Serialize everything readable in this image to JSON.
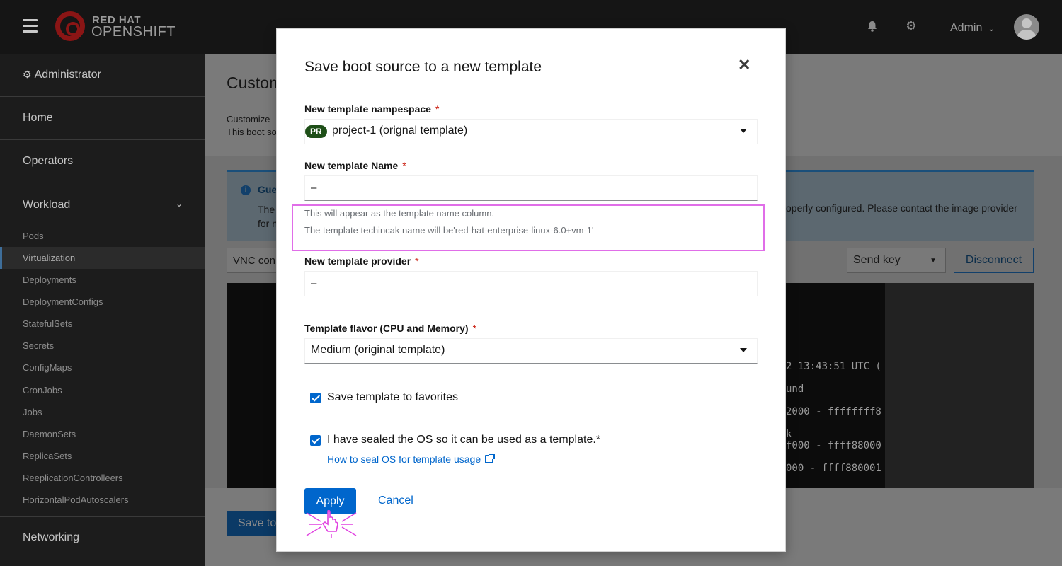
{
  "masthead": {
    "logo_top": "RED HAT",
    "logo_bottom": "OPENSHIFT",
    "user": "Admin"
  },
  "sidebar": {
    "perspective": "Administrator",
    "sections": [
      "Home",
      "Operators",
      "Workload",
      "Networking"
    ],
    "workload_items": [
      "Pods",
      "Virtualization",
      "Deployments",
      "DeploymentConfigs",
      "StatefulSets",
      "Secrets",
      "ConfigMaps",
      "CronJobs",
      "Jobs",
      "DaemonSets",
      "ReplicaSets",
      "ReeplicationControlleers",
      "HorizontalPodAutoscalers"
    ],
    "active_item": "Virtualization"
  },
  "background": {
    "page_title": "Custom",
    "desc_line1": "Customize",
    "desc_line2": "This boot so",
    "alert_title": "Gue",
    "alert_line1": "The",
    "alert_line2": "for n",
    "alert_right": "operly configured. Please contact the image provider",
    "vnc_select": "VNC con",
    "send_key": "Send key",
    "disconnect": "Disconnect",
    "console_lines": [
      "2 13:43:51 UTC (",
      "und",
      "2000 - ffffffff8",
      "k",
      "f000 - ffff88000",
      "000 - ffff880001"
    ],
    "save_to": "Save to"
  },
  "modal": {
    "title": "Save boot source to a new template",
    "namespace_label": "New template nampespace",
    "namespace_badge": "PR",
    "namespace_value": "project-1 (orignal template)",
    "name_label": "New template Name",
    "name_value": "–",
    "helper_line1": "This will appear as the template name column.",
    "helper_line2": "The template techincak name will be'red-hat-enterprise-linux-6.0+vm-1'",
    "provider_label": "New template provider",
    "provider_value": "–",
    "flavor_label": "Template flavor (CPU and Memory)",
    "flavor_value": "Medium (original template)",
    "favorites_label": "Save template to favorites",
    "favorites_checked": true,
    "sealed_label": "I have sealed the OS so it can be used as a template.*",
    "sealed_checked": true,
    "seal_link": "How to seal OS for template usage",
    "apply": "Apply",
    "cancel": "Cancel",
    "required_mark": "*"
  },
  "colors": {
    "primary": "#0066cc",
    "required": "#c9190b",
    "highlight": "#e06ee8",
    "masthead": "#151515"
  }
}
